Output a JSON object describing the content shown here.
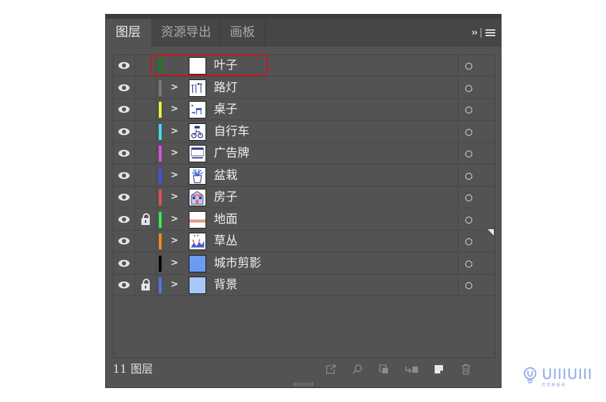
{
  "tabs": [
    {
      "label": "图层",
      "active": true
    },
    {
      "label": "资源导出",
      "active": false
    },
    {
      "label": "画板",
      "active": false
    }
  ],
  "tab_controls": {
    "overflow_glyph": "››",
    "menu_icon": "hamburger-menu-icon"
  },
  "layers": [
    {
      "name": "叶子",
      "color": "#1f7a1f",
      "locked": false,
      "visible": true,
      "expandable": false,
      "highlighted": true
    },
    {
      "name": "路灯",
      "color": "#7a7a7a",
      "locked": false,
      "visible": true,
      "expandable": true
    },
    {
      "name": "桌子",
      "color": "#f1f03a",
      "locked": false,
      "visible": true,
      "expandable": true
    },
    {
      "name": "自行车",
      "color": "#3fe1f2",
      "locked": false,
      "visible": true,
      "expandable": true
    },
    {
      "name": "广告牌",
      "color": "#e04ce8",
      "locked": false,
      "visible": true,
      "expandable": true
    },
    {
      "name": "盆栽",
      "color": "#4b4bea",
      "locked": false,
      "visible": true,
      "expandable": true
    },
    {
      "name": "房子",
      "color": "#e8524c",
      "locked": false,
      "visible": true,
      "expandable": true
    },
    {
      "name": "地面",
      "color": "#3cea52",
      "locked": true,
      "visible": true,
      "expandable": true
    },
    {
      "name": "草丛",
      "color": "#f08a1e",
      "locked": false,
      "visible": true,
      "expandable": true
    },
    {
      "name": "城市剪影",
      "color": "#000000",
      "locked": false,
      "visible": true,
      "expandable": true
    },
    {
      "name": "背景",
      "color": "#4a78e8",
      "locked": true,
      "visible": true,
      "expandable": true
    }
  ],
  "footer": {
    "layer_count": "11 图层",
    "icons": [
      "export-icon",
      "search-icon",
      "make-clip-mask-icon",
      "move-to-layer-icon",
      "new-layer-icon",
      "delete-icon"
    ]
  },
  "logo": {
    "word": "UIIIUIII",
    "sub": "优优教程网"
  }
}
